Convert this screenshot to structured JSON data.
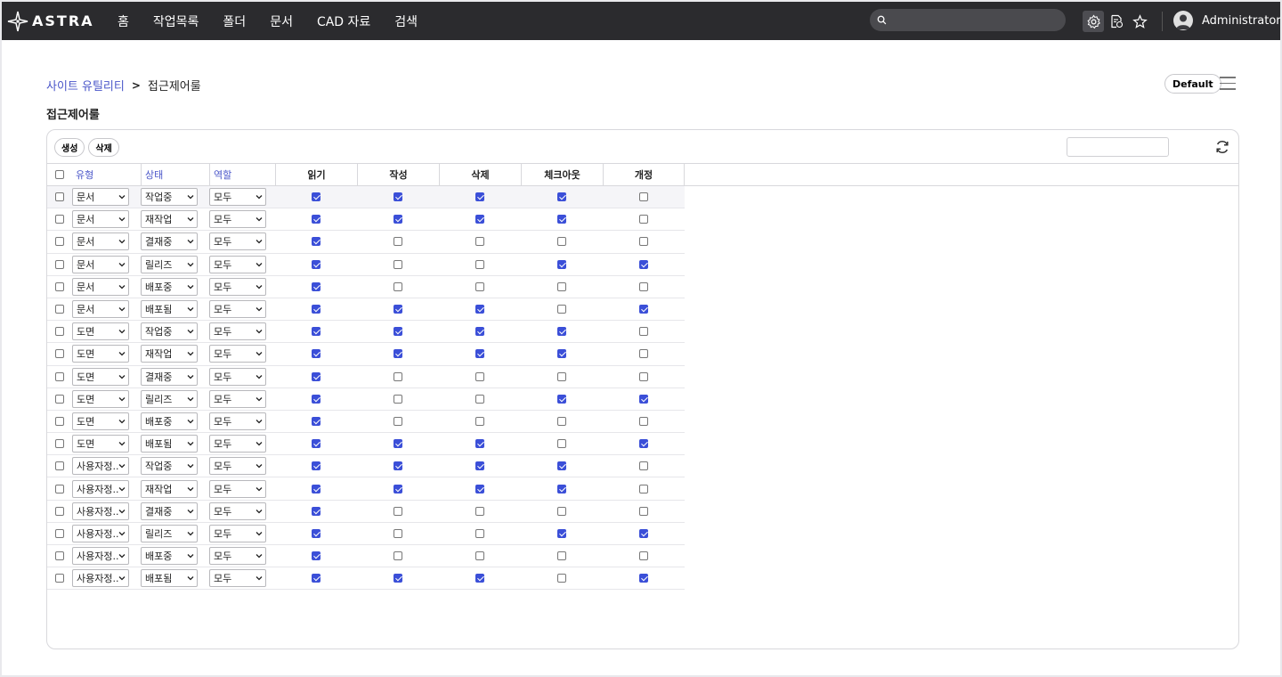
{
  "app": {
    "logo_text": "ASTRA",
    "nav": [
      "홈",
      "작업목록",
      "폴더",
      "문서",
      "CAD 자료",
      "검색"
    ],
    "user_name": "Administrator"
  },
  "breadcrumb": {
    "parent": "사이트 유틸리티",
    "separator": ">",
    "current": "접근제어룰"
  },
  "page_title": "접근제어룰",
  "default_button": "Default",
  "toolbar": {
    "create": "생성",
    "delete": "삭제"
  },
  "columns": {
    "type": "유형",
    "state": "상태",
    "role": "역할",
    "perms": [
      "읽기",
      "작성",
      "삭제",
      "체크아웃",
      "개정"
    ]
  },
  "accent_color": "#3b4fd8",
  "rows": [
    {
      "type": "문서",
      "state": "작업중",
      "role": "모두",
      "perms": [
        true,
        true,
        true,
        true,
        false
      ]
    },
    {
      "type": "문서",
      "state": "재작업",
      "role": "모두",
      "perms": [
        true,
        true,
        true,
        true,
        false
      ]
    },
    {
      "type": "문서",
      "state": "결재중",
      "role": "모두",
      "perms": [
        true,
        false,
        false,
        false,
        false
      ]
    },
    {
      "type": "문서",
      "state": "릴리즈",
      "role": "모두",
      "perms": [
        true,
        false,
        false,
        true,
        true
      ]
    },
    {
      "type": "문서",
      "state": "배포중",
      "role": "모두",
      "perms": [
        true,
        false,
        false,
        false,
        false
      ]
    },
    {
      "type": "문서",
      "state": "배포됨",
      "role": "모두",
      "perms": [
        true,
        true,
        true,
        false,
        true
      ]
    },
    {
      "type": "도면",
      "state": "작업중",
      "role": "모두",
      "perms": [
        true,
        true,
        true,
        true,
        false
      ]
    },
    {
      "type": "도면",
      "state": "재작업",
      "role": "모두",
      "perms": [
        true,
        true,
        true,
        true,
        false
      ]
    },
    {
      "type": "도면",
      "state": "결재중",
      "role": "모두",
      "perms": [
        true,
        false,
        false,
        false,
        false
      ]
    },
    {
      "type": "도면",
      "state": "릴리즈",
      "role": "모두",
      "perms": [
        true,
        false,
        false,
        true,
        true
      ]
    },
    {
      "type": "도면",
      "state": "배포중",
      "role": "모두",
      "perms": [
        true,
        false,
        false,
        false,
        false
      ]
    },
    {
      "type": "도면",
      "state": "배포됨",
      "role": "모두",
      "perms": [
        true,
        true,
        true,
        false,
        true
      ]
    },
    {
      "type": "사용자정...",
      "state": "작업중",
      "role": "모두",
      "perms": [
        true,
        true,
        true,
        true,
        false
      ]
    },
    {
      "type": "사용자정...",
      "state": "재작업",
      "role": "모두",
      "perms": [
        true,
        true,
        true,
        true,
        false
      ]
    },
    {
      "type": "사용자정...",
      "state": "결재중",
      "role": "모두",
      "perms": [
        true,
        false,
        false,
        false,
        false
      ]
    },
    {
      "type": "사용자정...",
      "state": "릴리즈",
      "role": "모두",
      "perms": [
        true,
        false,
        false,
        true,
        true
      ]
    },
    {
      "type": "사용자정...",
      "state": "배포중",
      "role": "모두",
      "perms": [
        true,
        false,
        false,
        false,
        false
      ]
    },
    {
      "type": "사용자정...",
      "state": "배포됨",
      "role": "모두",
      "perms": [
        true,
        true,
        true,
        false,
        true
      ]
    }
  ]
}
